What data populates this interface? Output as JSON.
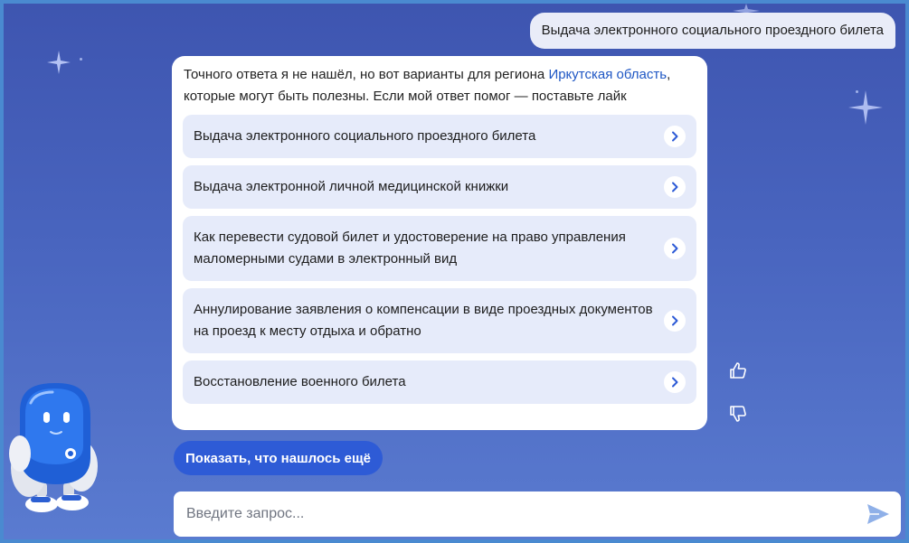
{
  "user_message": "Выдача электронного социального проездного билета",
  "bot": {
    "intro_before_link": "Точного ответа я не нашёл, но вот варианты для региона ",
    "region_link": "Иркутская область",
    "intro_after_link": ", которые могут быть полезны. Если мой ответ помог — поставьте лайк",
    "options": [
      {
        "label": "Выдача электронного социального проездного билета"
      },
      {
        "label": "Выдача электронной личной медицинской книжки"
      },
      {
        "label": "Как перевести судовой билет и удостоверение на право управления маломерными судами в электронный вид"
      },
      {
        "label": "Аннулирование заявления о компенсации в виде проездных документов на проезд к месту отдыха и обратно"
      },
      {
        "label": "Восстановление военного билета"
      }
    ]
  },
  "show_more_label": "Показать, что нашлось ещё",
  "reactions": {
    "like_icon": "thumbs-up-icon",
    "dislike_icon": "thumbs-down-icon"
  },
  "input": {
    "placeholder": "Введите запрос...",
    "value": ""
  },
  "colors": {
    "background": "#4560bb",
    "accent": "#2e5bd6",
    "option_bg": "#e6ebfa",
    "link": "#1f57c4"
  },
  "icons": {
    "send": "send-icon",
    "chevron": "chevron-right-icon",
    "mascot": "robot-mascot",
    "sparkle": "sparkle-icon"
  }
}
